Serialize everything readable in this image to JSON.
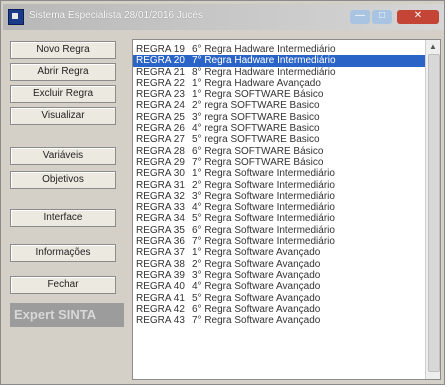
{
  "window": {
    "title": "Sistema Especialista 28/01/2016 Jucés",
    "controls": {
      "minimize": "—",
      "maximize": "□",
      "close": "✕"
    }
  },
  "buttons": [
    {
      "label": "Novo Regra"
    },
    {
      "label": "Abrir Regra"
    },
    {
      "label": "Excluir Regra"
    },
    {
      "label": "Visualizar"
    },
    {
      "label": "Variáveis"
    },
    {
      "label": "Objetivos"
    },
    {
      "label": "Interface"
    },
    {
      "label": "Informações"
    },
    {
      "label": "Fechar"
    }
  ],
  "brand": "Expert SINTA",
  "rules": [
    {
      "id": "REGRA 19",
      "text": "6° Regra Hadware Intermediário"
    },
    {
      "id": "REGRA 20",
      "text": "7° Regra Hadware Intermediário"
    },
    {
      "id": "REGRA 21",
      "text": "8° Regra Hadware Intermediário"
    },
    {
      "id": "REGRA 22",
      "text": "1° Regra Hadware Avançado"
    },
    {
      "id": "REGRA 23",
      "text": "1° Regra SOFTWARE Básico"
    },
    {
      "id": "REGRA 24",
      "text": "2° regra SOFTWARE Basico"
    },
    {
      "id": "REGRA 25",
      "text": "3° regra SOFTWARE Basico"
    },
    {
      "id": "REGRA 26",
      "text": "4° regra SOFTWARE Basico"
    },
    {
      "id": "REGRA 27",
      "text": "5° regra SOFTWARE Basico"
    },
    {
      "id": "REGRA 28",
      "text": "6° Regra SOFTWARE Básico"
    },
    {
      "id": "REGRA 29",
      "text": "7° Regra SOFTWARE Básico"
    },
    {
      "id": "REGRA 30",
      "text": "1° Regra Software Intermediário"
    },
    {
      "id": "REGRA 31",
      "text": "2° Regra Software Intermediário"
    },
    {
      "id": "REGRA 32",
      "text": "3° Regra Software Intermediário"
    },
    {
      "id": "REGRA 33",
      "text": "4° Regra Software Intermediário"
    },
    {
      "id": "REGRA 34",
      "text": "5° Regra Software Intermediário"
    },
    {
      "id": "REGRA 35",
      "text": "6° Regra Software Intermediário"
    },
    {
      "id": "REGRA 36",
      "text": "7° Regra Software Intermediário"
    },
    {
      "id": "REGRA 37",
      "text": "1° Regra Software Avançado"
    },
    {
      "id": "REGRA 38",
      "text": "2° Regra Software Avançado"
    },
    {
      "id": "REGRA 39",
      "text": "3° Regra Software Avançado"
    },
    {
      "id": "REGRA 40",
      "text": "4° Regra Software Avançado"
    },
    {
      "id": "REGRA 41",
      "text": "5° Regra Software Avançado"
    },
    {
      "id": "REGRA 42",
      "text": "6° Regra Software Avançado"
    },
    {
      "id": "REGRA 43",
      "text": "7° Regra Software Avançado"
    }
  ],
  "selected_rule": "REGRA 20",
  "colors": {
    "selection": "#2a64c6",
    "close_button": "#c44536",
    "brand_banner": "#9c9c9c"
  }
}
